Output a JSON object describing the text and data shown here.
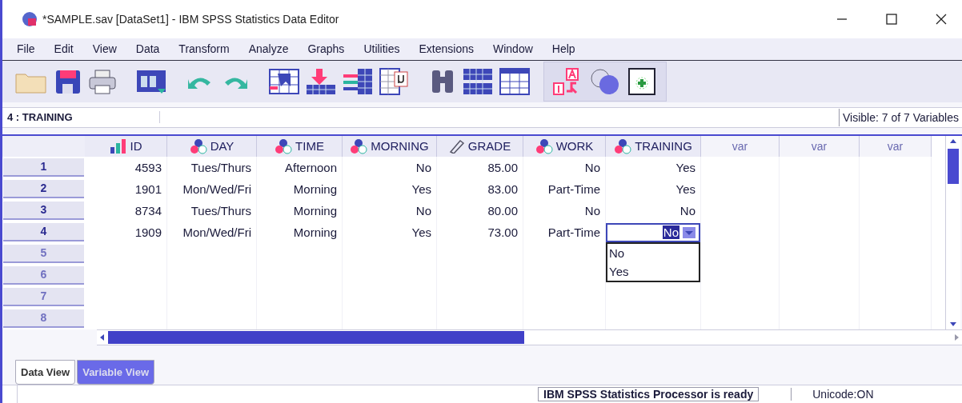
{
  "window": {
    "title": "*SAMPLE.sav [DataSet1] - IBM SPSS Statistics Data Editor"
  },
  "menu": [
    "File",
    "Edit",
    "View",
    "Data",
    "Transform",
    "Analyze",
    "Graphs",
    "Utilities",
    "Extensions",
    "Window",
    "Help"
  ],
  "cell_info": {
    "location": "4 : TRAINING",
    "visible": "Visible: 7 of 7 Variables"
  },
  "columns": [
    {
      "name": "ID",
      "kind": "ordinal"
    },
    {
      "name": "DAY",
      "kind": "nominal"
    },
    {
      "name": "TIME",
      "kind": "nominal"
    },
    {
      "name": "MORNING",
      "kind": "nominal"
    },
    {
      "name": "GRADE",
      "kind": "scale"
    },
    {
      "name": "WORK",
      "kind": "nominal"
    },
    {
      "name": "TRAINING",
      "kind": "nominal"
    },
    {
      "name": "var",
      "kind": "empty"
    },
    {
      "name": "var",
      "kind": "empty"
    },
    {
      "name": "var",
      "kind": "empty"
    }
  ],
  "rows": [
    {
      "number": "1",
      "cells": [
        "4593",
        "Tues/Thurs",
        "Afternoon",
        "No",
        "85.00",
        "No",
        "Yes"
      ]
    },
    {
      "number": "2",
      "cells": [
        "1901",
        "Mon/Wed/Fri",
        "Morning",
        "Yes",
        "83.00",
        "Part-Time",
        "Yes"
      ]
    },
    {
      "number": "3",
      "cells": [
        "8734",
        "Tues/Thurs",
        "Morning",
        "No",
        "80.00",
        "No",
        "No"
      ]
    },
    {
      "number": "4",
      "cells": [
        "1909",
        "Mon/Wed/Fri",
        "Morning",
        "Yes",
        "73.00",
        "Part-Time"
      ],
      "editor": {
        "value": "No",
        "options": [
          "No",
          "Yes"
        ]
      }
    },
    {
      "number": "5"
    },
    {
      "number": "6"
    },
    {
      "number": "7"
    },
    {
      "number": "8"
    }
  ],
  "tabs": [
    {
      "label": "Data View",
      "selected": true
    },
    {
      "label": "Variable View",
      "selected": false
    }
  ],
  "status_bar": {
    "message": "IBM SPSS Statistics Processor is ready",
    "encoding": "Unicode:ON"
  }
}
